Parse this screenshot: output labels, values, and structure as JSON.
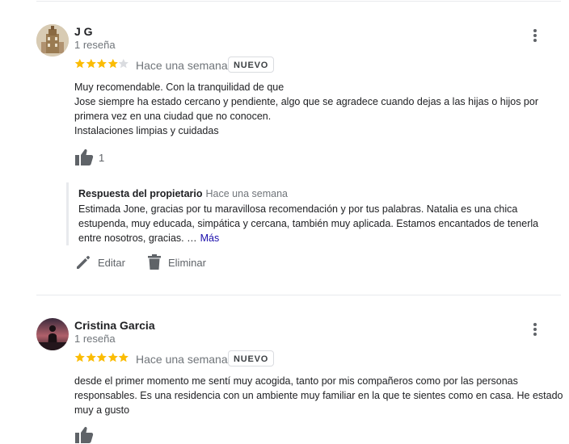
{
  "reviews": [
    {
      "reviewer_name": "J G",
      "review_count": "1 reseña",
      "rating": 4,
      "time": "Hace una semana",
      "badge": "NUEVO",
      "text": "Muy recomendable. Con la tranquilidad de que\nJose siempre ha estado cercano y pendiente, algo que se agradece cuando dejas a las hijas o hijos por primera vez en una ciudad que no conocen.\nInstalaciones limpias y cuidadas",
      "likes": "1",
      "owner_reply": {
        "title": "Respuesta del propietario",
        "time": "Hace una semana",
        "text": "Estimada Jone, gracias por tu maravillosa recomendación y por tus palabras. Natalia es una chica estupenda, muy educada, simpática y cercana, también muy aplicada. Estamos encantados de tenerla entre nosotros, gracias. …",
        "more_label": "Más"
      },
      "actions": {
        "edit_label": "Editar",
        "delete_label": "Eliminar"
      }
    },
    {
      "reviewer_name": "Cristina Garcia",
      "review_count": "1 reseña",
      "rating": 5,
      "time": "Hace una semana",
      "badge": "NUEVO",
      "text": "desde el primer momento me sentí muy acogida, tanto por mis compañeros como por las personas responsables. Es una residencia con un ambiente muy familiar en la que te sientes como en casa. He estado muy a gusto"
    }
  ],
  "colors": {
    "star_filled": "#fbbc04",
    "star_empty": "#dadce0",
    "link": "#1a0dab",
    "secondary_text": "#70757a",
    "icon": "#5f6368"
  },
  "icons": [
    "avatar",
    "more-vert-icon",
    "star-icon",
    "thumb-up-icon",
    "pencil-icon",
    "trash-icon"
  ]
}
